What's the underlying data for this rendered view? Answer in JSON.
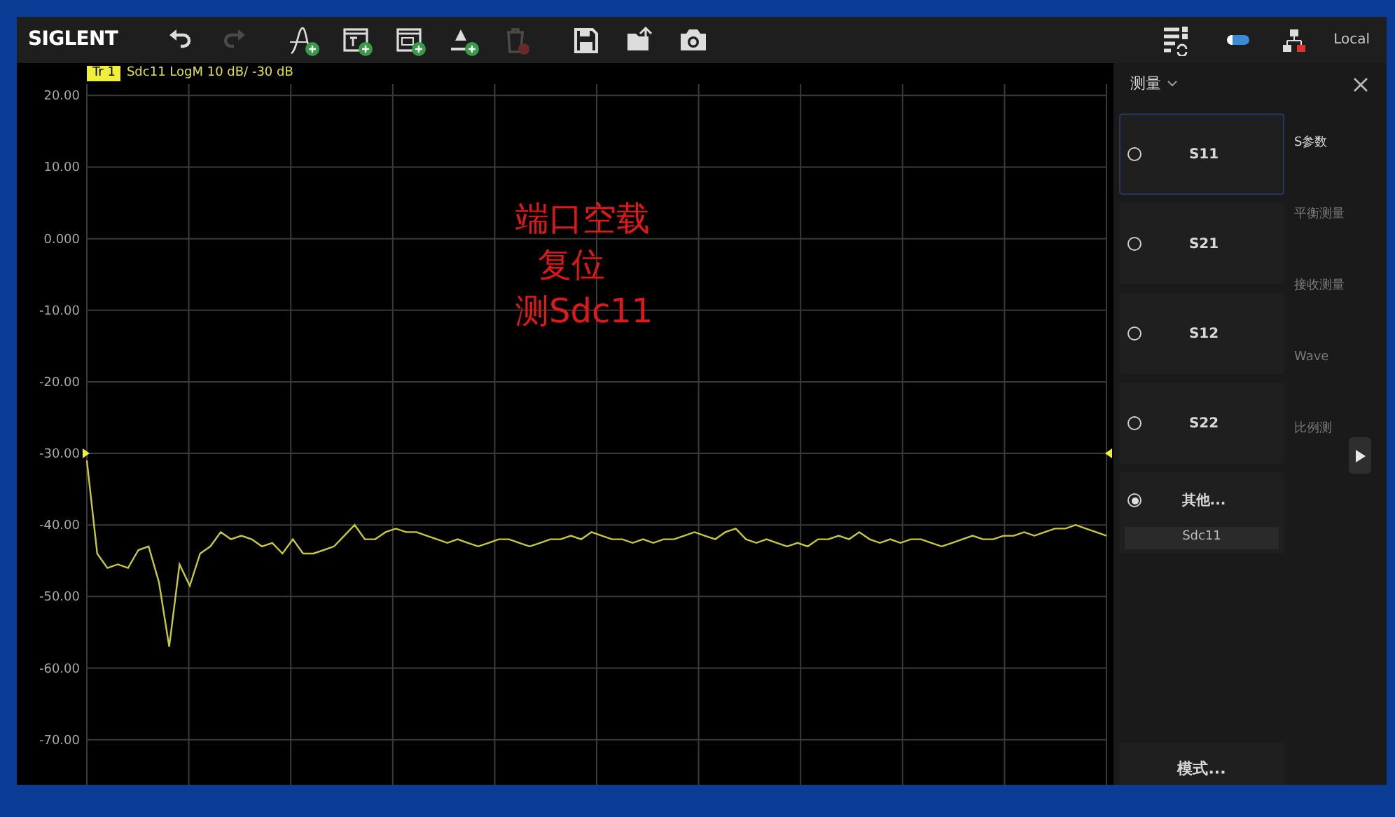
{
  "toolbar": {
    "logo": "SIGLENT",
    "status": "Local",
    "buttons": [
      {
        "kind": "undo",
        "disabled": false
      },
      {
        "kind": "redo",
        "disabled": true
      },
      {
        "kind": "trace-add",
        "disabled": false
      },
      {
        "kind": "window-add",
        "disabled": false
      },
      {
        "kind": "channel-add",
        "disabled": false
      },
      {
        "kind": "marker-add",
        "disabled": false
      },
      {
        "kind": "delete",
        "disabled": true
      },
      {
        "kind": "save",
        "disabled": false
      },
      {
        "kind": "open",
        "disabled": false
      },
      {
        "kind": "camera",
        "disabled": false
      }
    ]
  },
  "trace": {
    "badge": "Tr 1",
    "label": "Sdc11 LogM 10 dB/ -30 dB"
  },
  "chart": {
    "chart_data": {
      "type": "line",
      "grid": true,
      "ylim": [
        -76.3,
        21.6
      ],
      "yticks": [
        {
          "value": 20,
          "label": "20.00"
        },
        {
          "value": 10,
          "label": "10.00"
        },
        {
          "value": 0,
          "label": "0.000"
        },
        {
          "value": -10,
          "label": "-10.00"
        },
        {
          "value": -20,
          "label": "-20.00"
        },
        {
          "value": -30,
          "label": "-30.00"
        },
        {
          "value": -40,
          "label": "-40.00"
        },
        {
          "value": -50,
          "label": "-50.00"
        },
        {
          "value": -60,
          "label": "-60.00"
        },
        {
          "value": -70,
          "label": "-70.00"
        }
      ],
      "series": [
        {
          "color": "#c8c83a",
          "values": [
            -31,
            -44,
            -46,
            -45.5,
            -46,
            -43.5,
            -43,
            -48,
            -57,
            -45.5,
            -48.5,
            -44,
            -43,
            -41,
            -42,
            -41.5,
            -42,
            -43,
            -42.5,
            -44,
            -42,
            -44,
            -44,
            -43.5,
            -43,
            -41.5,
            -40,
            -42,
            -42,
            -41,
            -40.5,
            -41,
            -41,
            -41.5,
            -42,
            -42.5,
            -42,
            -42.5,
            -43,
            -42.5,
            -42,
            -42,
            -42.5,
            -43,
            -42.5,
            -42,
            -42,
            -41.5,
            -42,
            -41,
            -41.5,
            -42,
            -42,
            -42.5,
            -42,
            -42.5,
            -42,
            -42,
            -41.5,
            -41,
            -41.5,
            -42,
            -41,
            -40.5,
            -42,
            -42.5,
            -42,
            -42.5,
            -43,
            -42.5,
            -43,
            -42,
            -42,
            -41.5,
            -42,
            -41,
            -42,
            -42.5,
            -42,
            -42.5,
            -42,
            -42,
            -42.5,
            -43,
            -42.5,
            -42,
            -41.5,
            -42,
            -42,
            -41.5,
            -41.5,
            -41,
            -41.5,
            -41,
            -40.5,
            -40.5,
            -40,
            -40.5,
            -41,
            -41.5
          ]
        }
      ]
    }
  },
  "annotation": [
    "端口空载",
    "复位",
    "测Sdc11"
  ],
  "panel": {
    "title": "测量",
    "mode_button": "模式...",
    "measurements": [
      {
        "label": "S11",
        "selected": false,
        "focused": true
      },
      {
        "label": "S21",
        "selected": false,
        "focused": false
      },
      {
        "label": "S12",
        "selected": false,
        "focused": false
      },
      {
        "label": "S22",
        "selected": false,
        "focused": false
      },
      {
        "label": "其他...",
        "selected": true,
        "focused": false,
        "value": "Sdc11"
      }
    ],
    "categories": [
      {
        "label": "S参数",
        "selected": true
      },
      {
        "label": "平衡测量",
        "selected": false
      },
      {
        "label": "接收测量",
        "selected": false
      },
      {
        "label": "Wave",
        "selected": false
      },
      {
        "label": "比例测",
        "selected": false
      }
    ]
  }
}
